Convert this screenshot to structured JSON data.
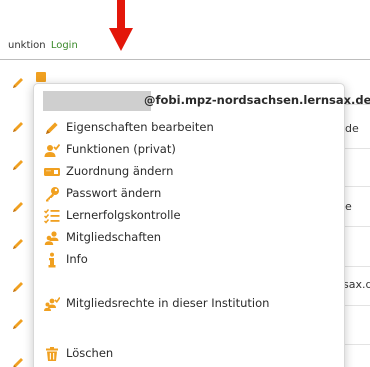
{
  "background": {
    "header_prefix": "unktion",
    "header_login": "Login",
    "row_fragments": [
      "de",
      "e",
      "sax.d"
    ]
  },
  "menu": {
    "email_domain": "@fobi.mpz-nordsachsen.lernsax.de",
    "items": [
      {
        "label": "Eigenschaften bearbeiten",
        "icon": "pencil-icon"
      },
      {
        "label": "Funktionen (privat)",
        "icon": "user-check-icon"
      },
      {
        "label": "Zuordnung ändern",
        "icon": "id-card-icon"
      },
      {
        "label": "Passwort ändern",
        "icon": "key-icon"
      },
      {
        "label": "Lernerfolgskontrolle",
        "icon": "checklist-icon"
      },
      {
        "label": "Mitgliedschaften",
        "icon": "users-icon"
      },
      {
        "label": "Info",
        "icon": "info-icon"
      },
      {
        "label": "Mitgliedsrechte in dieser Institution",
        "icon": "users-check-icon"
      },
      {
        "label": "Löschen",
        "icon": "trash-icon"
      }
    ]
  },
  "colors": {
    "accent_orange": "#f0a020",
    "login_green": "#3a8a2a",
    "arrow_red": "#e3170a"
  }
}
